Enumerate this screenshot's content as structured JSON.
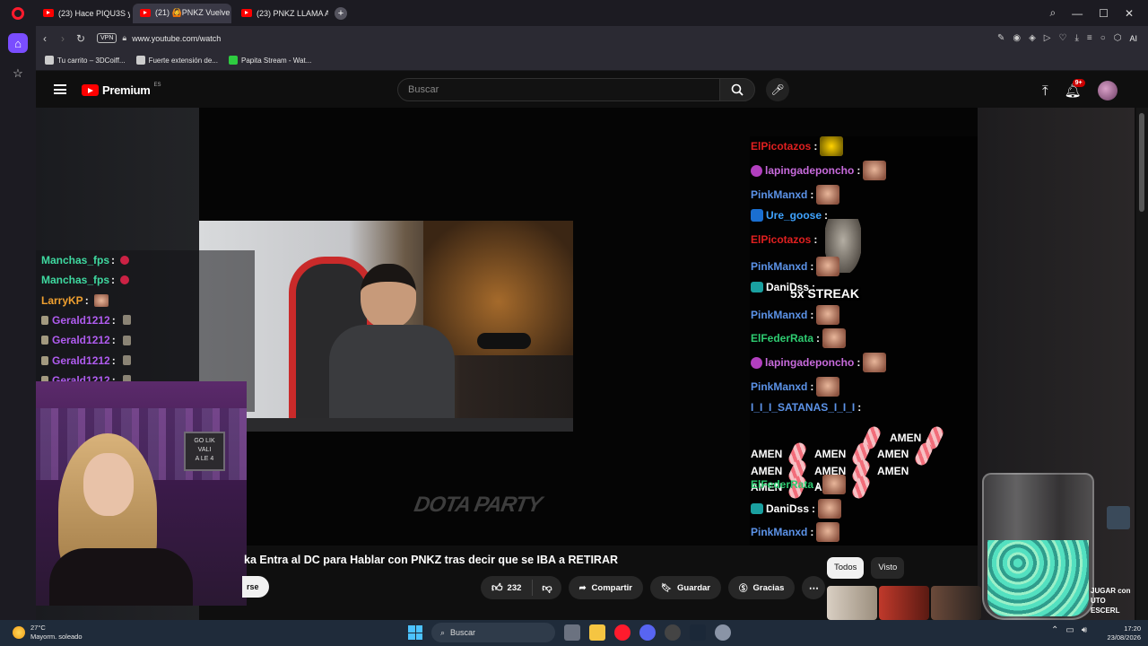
{
  "browser": {
    "tabs": [
      {
        "label": "(23) Hace PIQU3S y...",
        "active": false
      },
      {
        "label": "(21) 🙆PNKZ Vuelve c",
        "active": true
      },
      {
        "label": "(23) PNKZ LLAMA A SU VI",
        "active": false
      }
    ],
    "new_tab_glyph": "+",
    "url": "www.youtube.com/watch",
    "vpn_label": "VPN",
    "ai_label": "AI",
    "bookmarks": [
      "Tu carrito – 3DCoiff...",
      "Fuerte extensión de...",
      "Papita Stream - Wat..."
    ]
  },
  "youtube": {
    "logo_text": "Premium",
    "logo_region": "ES",
    "search_placeholder": "Buscar",
    "notifications_badge": "9+",
    "video_title": "ka Entra al DC para Hablar con PNKZ tras decir que se IBA a RETIRAR",
    "subscribe_fragment": "rse",
    "like_count": "232",
    "share_label": "Compartir",
    "save_label": "Guardar",
    "thanks_label": "Gracias",
    "chips": [
      "Todos",
      "Visto"
    ],
    "overlay_logo": "DOTA PARTY",
    "streak_text": "5x STREAK",
    "side_text": "JUGAR con\nUTO\nESCERL",
    "webcam_sign": "GO LIK\nVALI\nA LE 4",
    "colors": {
      "accent": "#ff0000",
      "chip_selected": "#f1f1f1"
    }
  },
  "chat_right": [
    {
      "user": "ElPicotazos",
      "color": "#e02020",
      "emote": "gold",
      "badge": null
    },
    {
      "user": "lapingadeponcho",
      "color": "#c86bdc",
      "emote": "face",
      "badge": "pink"
    },
    {
      "user": "PinkManxd",
      "color": "#5c93e8",
      "emote": "face",
      "badge": null
    },
    {
      "user": "Ure_goose",
      "color": "#3fa3ff",
      "emote": null,
      "badge": "blue"
    },
    {
      "user": "ElPicotazos",
      "color": "#e02020",
      "emote": null,
      "badge": null
    },
    {
      "user": "PinkManxd",
      "color": "#5c93e8",
      "emote": "face",
      "badge": null
    },
    {
      "user": "DaniDss",
      "color": "#ffffff",
      "emote": null,
      "badge": "teal"
    },
    {
      "user": "PinkManxd",
      "color": "#5c93e8",
      "emote": "face",
      "badge": null
    },
    {
      "user": "ElFederRata",
      "color": "#2ecc71",
      "emote": "face",
      "badge": null
    },
    {
      "user": "lapingadeponcho",
      "color": "#c86bdc",
      "emote": "face",
      "badge": "pink"
    },
    {
      "user": "PinkManxd",
      "color": "#5c93e8",
      "emote": "face",
      "badge": null
    },
    {
      "user": "I_I_I_SATANAS_I_I_I",
      "color": "#5c93e8",
      "emote": null,
      "badge": null
    },
    {
      "user": "ElFederRata",
      "color": "#2ecc71",
      "emote": "face",
      "badge": null
    },
    {
      "user": "DaniDss",
      "color": "#ffffff",
      "emote": "face",
      "badge": "teal"
    },
    {
      "user": "PinkManxd",
      "color": "#5c93e8",
      "emote": "face",
      "badge": null
    }
  ],
  "amen_word": "AMEN",
  "chat_left": [
    {
      "user": "Manchas_fps",
      "color": "#3fd9a0",
      "icon": "dot"
    },
    {
      "user": "Manchas_fps",
      "color": "#3fd9a0",
      "icon": "dot"
    },
    {
      "user": "LarryKP",
      "color": "#f0a030",
      "icon": "face"
    },
    {
      "user": "Gerald1212",
      "color": "#b05cf0",
      "icon": "rock"
    },
    {
      "user": "Gerald1212",
      "color": "#b05cf0",
      "icon": "rock"
    },
    {
      "user": "Gerald1212",
      "color": "#b05cf0",
      "icon": "rock"
    },
    {
      "user": "Gerald1212",
      "color": "#b05cf0",
      "icon": "rock"
    },
    {
      "user": "Gerald1212",
      "color": "#b05cf0",
      "icon": "rock"
    }
  ],
  "taskbar": {
    "weather_temp": "27°C",
    "weather_desc": "Mayorm. soleado",
    "search_label": "Buscar",
    "time": "17:20",
    "date": "23/08/2026"
  }
}
